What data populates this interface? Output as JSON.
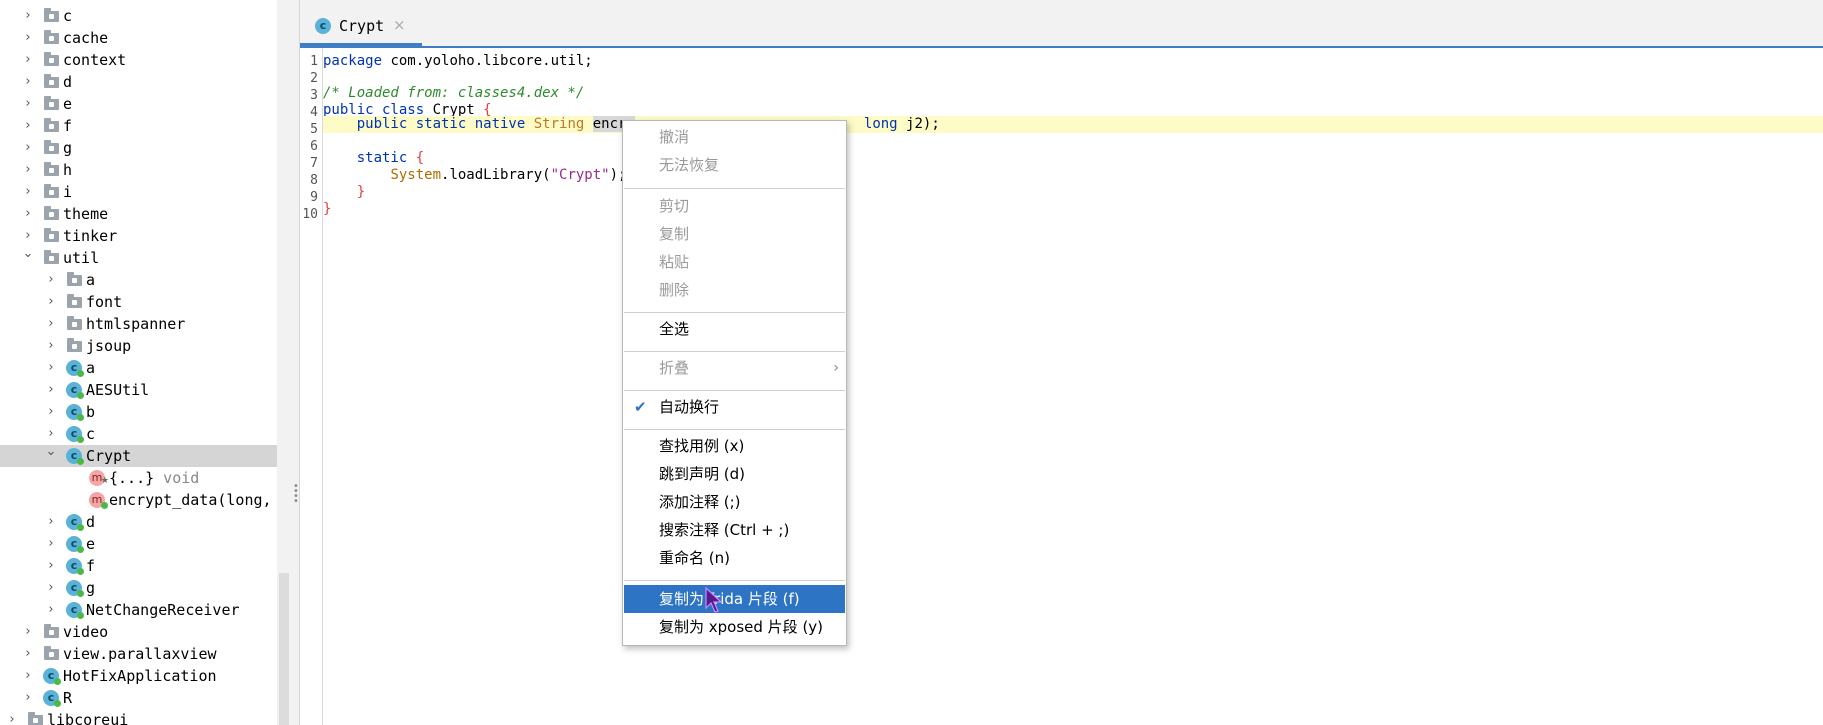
{
  "tree": {
    "top_partial_label": "c",
    "items": [
      {
        "label": "c",
        "icon": "folder-icon",
        "indent": 0
      },
      {
        "label": "cache",
        "icon": "folder-icon",
        "indent": 0
      },
      {
        "label": "context",
        "icon": "folder-icon",
        "indent": 0
      },
      {
        "label": "d",
        "icon": "folder-icon",
        "indent": 0
      },
      {
        "label": "e",
        "icon": "folder-icon",
        "indent": 0
      },
      {
        "label": "f",
        "icon": "folder-icon",
        "indent": 0
      },
      {
        "label": "g",
        "icon": "folder-icon",
        "indent": 0
      },
      {
        "label": "h",
        "icon": "folder-icon",
        "indent": 0
      },
      {
        "label": "i",
        "icon": "folder-icon",
        "indent": 0
      },
      {
        "label": "theme",
        "icon": "folder-icon",
        "indent": 0
      },
      {
        "label": "tinker",
        "icon": "folder-icon",
        "indent": 0
      },
      {
        "label": "util",
        "icon": "folder-icon",
        "indent": 0,
        "expanded": true
      },
      {
        "label": "a",
        "icon": "folder-icon",
        "indent": 1
      },
      {
        "label": "font",
        "icon": "folder-icon",
        "indent": 1
      },
      {
        "label": "htmlspanner",
        "icon": "folder-icon",
        "indent": 1
      },
      {
        "label": "jsoup",
        "icon": "folder-icon",
        "indent": 1
      },
      {
        "label": "a",
        "icon": "class-icon",
        "indent": 1
      },
      {
        "label": "AESUtil",
        "icon": "class-icon",
        "indent": 1
      },
      {
        "label": "b",
        "icon": "class-icon",
        "indent": 1
      },
      {
        "label": "c",
        "icon": "class-icon",
        "indent": 1
      },
      {
        "label": "Crypt",
        "icon": "class-icon",
        "indent": 1,
        "expanded": true,
        "selected": true
      },
      {
        "label": "{...}",
        "suffix": "void",
        "icon": "method-icon",
        "indent": 2
      },
      {
        "label": "encrypt_data(long,",
        "icon": "method-icon",
        "indent": 2
      },
      {
        "label": "d",
        "icon": "class-icon",
        "indent": 1
      },
      {
        "label": "e",
        "icon": "class-icon",
        "indent": 1
      },
      {
        "label": "f",
        "icon": "class-icon",
        "indent": 1
      },
      {
        "label": "g",
        "icon": "class-icon",
        "indent": 1
      },
      {
        "label": "NetChangeReceiver",
        "icon": "class-icon",
        "indent": 1
      },
      {
        "label": "video",
        "icon": "folder-icon",
        "indent": 0
      },
      {
        "label": "view.parallaxview",
        "icon": "folder-icon",
        "indent": 0
      },
      {
        "label": "HotFixApplication",
        "icon": "class-icon",
        "indent": 0
      },
      {
        "label": "R",
        "icon": "class-icon",
        "indent": 0
      },
      {
        "label": "libcoreui",
        "icon": "folder-icon",
        "indent": -1
      }
    ]
  },
  "editor": {
    "tab_label": "Crypt",
    "tab_close": "×",
    "line_numbers": [
      "1",
      "2",
      "3",
      "4",
      "5",
      "6",
      "7",
      "8",
      "9",
      "10"
    ],
    "code": {
      "l1_kw": "package",
      "l1_rest": " com.yoloho.libcore.util;",
      "l3_comment": "/* Loaded from: classes4.dex */",
      "l4_kw": "public class",
      "l4_name": " Crypt ",
      "l4_brace": "{",
      "l5_indent": "    ",
      "l5_kw": "public static native",
      "l5_type": " String ",
      "l5_sel": "encry",
      "l5_tail_kw": "long",
      "l5_tail": " j2);",
      "l7_kw": "    static",
      "l7_brace": " {",
      "l8_indent": "        ",
      "l8_sys": "System",
      "l8_call": ".loadLibrary(",
      "l8_str": "\"Crypt\"",
      "l8_end": ");",
      "l9_brace": "    }",
      "l10_brace": "}"
    }
  },
  "context_menu": {
    "undo": "撤消",
    "redo": "无法恢复",
    "cut": "剪切",
    "copy": "复制",
    "paste": "粘贴",
    "delete": "删除",
    "select_all": "全选",
    "fold": "折叠",
    "fold_arrow": "›",
    "word_wrap": "自动换行",
    "check": "✔",
    "find_usages": "查找用例 (x)",
    "goto_declaration": "跳到声明 (d)",
    "add_comment": "添加注释 (;)",
    "search_comment": "搜索注释 (Ctrl + ;)",
    "rename": "重命名 (n)",
    "copy_frida": "复制为 frida 片段 (f)",
    "copy_xposed": "复制为 xposed 片段 (y)"
  }
}
